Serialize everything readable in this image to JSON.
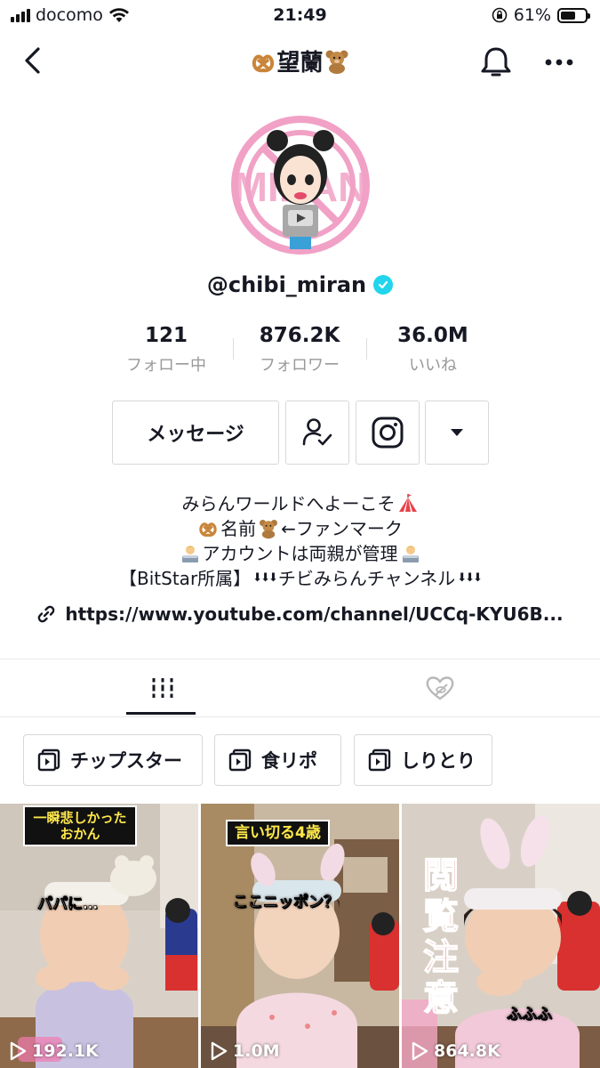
{
  "status_bar": {
    "carrier": "docomo",
    "time": "21:49",
    "battery": "61%",
    "battery_level": 0.61
  },
  "header": {
    "title": "望蘭"
  },
  "profile": {
    "username": "@chibi_miran",
    "verified": true,
    "avatar_text": "MIRAN"
  },
  "stats": {
    "following": {
      "value": "121",
      "label": "フォロー中"
    },
    "followers": {
      "value": "876.2K",
      "label": "フォロワー"
    },
    "likes": {
      "value": "36.0M",
      "label": "いいね"
    }
  },
  "actions": {
    "message_label": "メッセージ"
  },
  "bio": {
    "line1": "みらんワールドへよーこそ",
    "line2a": "名前",
    "line2b": "←ファンマーク",
    "line3": "アカウントは両親が管理",
    "line4a": "【BitStar所属】",
    "line4b": "⬇⬇⬇",
    "line4c": "チビみらんチャンネル",
    "line4d": "⬇⬇⬇"
  },
  "link": {
    "text": "https://www.youtube.com/channel/UCCq-KYU6B..."
  },
  "playlists": [
    {
      "label": "チップスター"
    },
    {
      "label": "食リポ"
    },
    {
      "label": "しりとり"
    }
  ],
  "videos": [
    {
      "caption": "一瞬悲しかったおかん",
      "caption_l1": "一瞬悲しかった",
      "caption_l2": "おかん",
      "overlay": "パパに…",
      "views": "192.1K"
    },
    {
      "caption": "言い切る4歳",
      "overlay": "ここニッポン？",
      "views": "1.0M"
    },
    {
      "caption": "閲覧注意",
      "c1": "閲",
      "c2": "覧",
      "c3": "注",
      "c4": "意",
      "overlay": "ふふふ",
      "views": "864.8K"
    }
  ],
  "colors": {
    "text": "#161823",
    "secondary": "#999999",
    "border": "#d8d8d8",
    "verified": "#20d5ec",
    "avatar_bg": "#f1a1c6"
  }
}
